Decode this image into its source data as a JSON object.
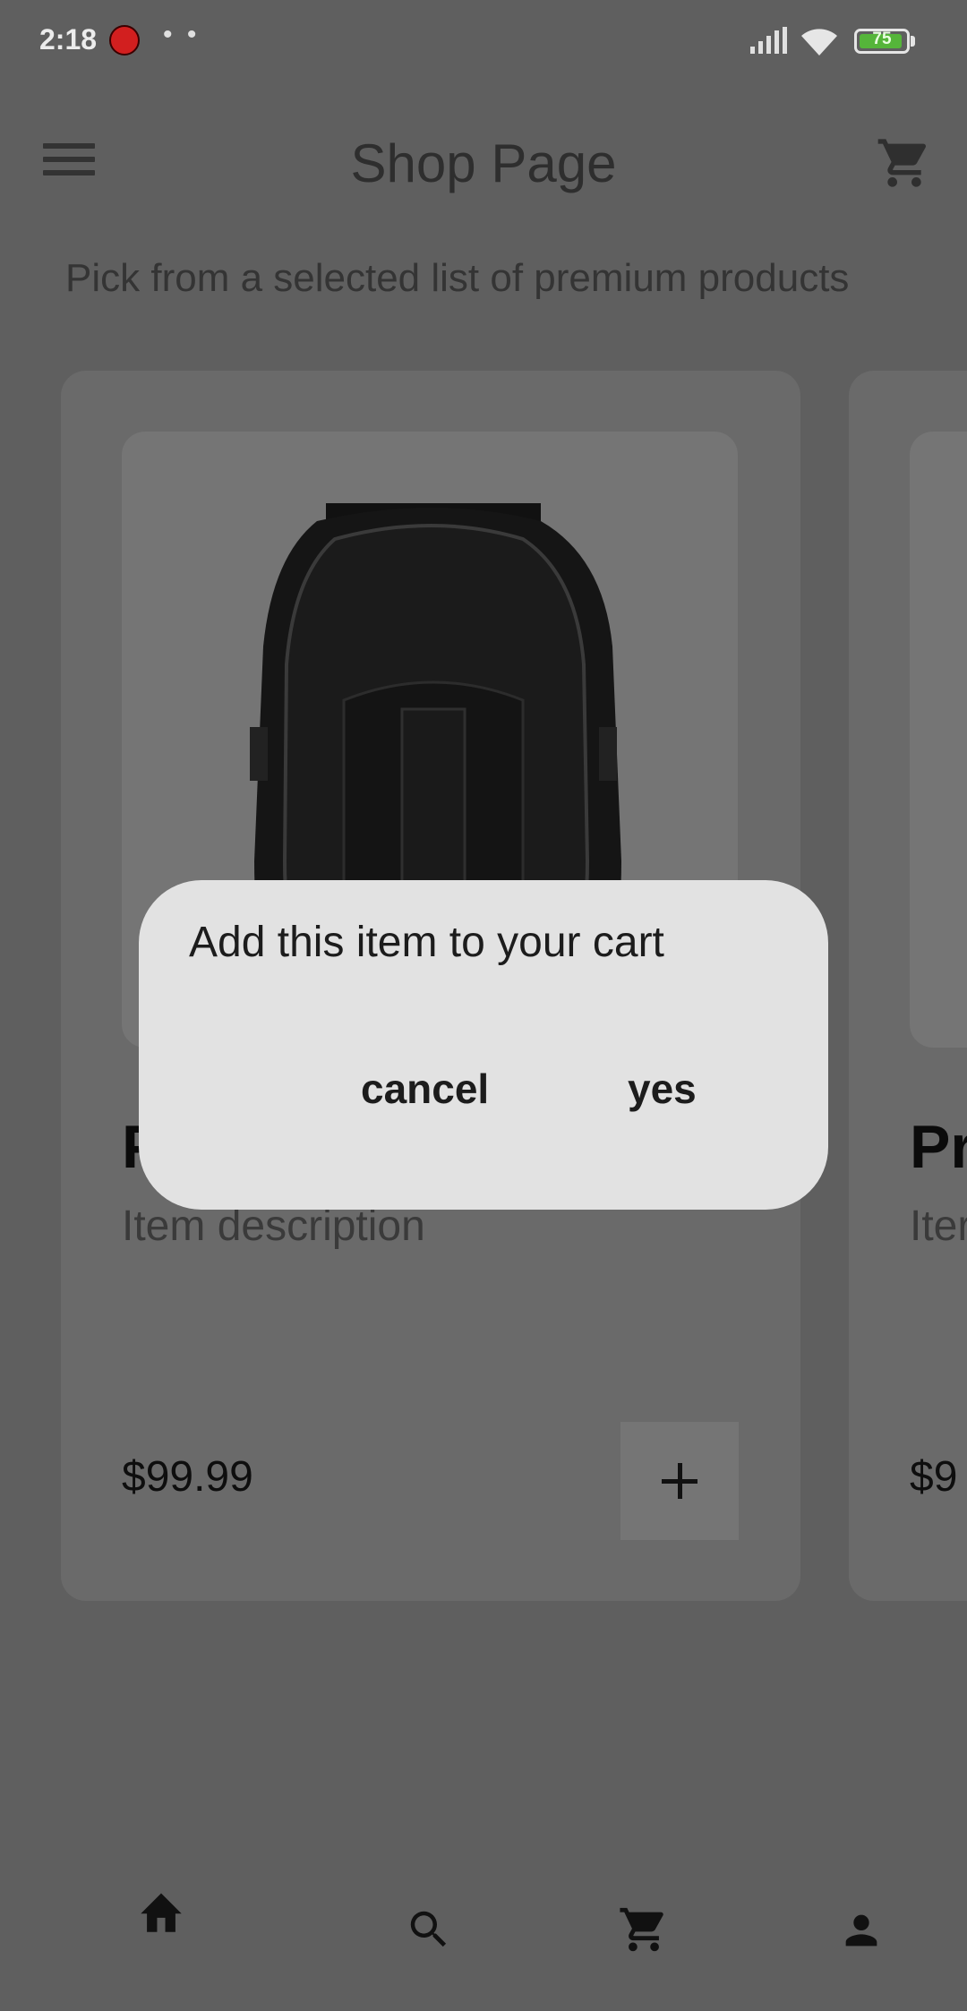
{
  "status_bar": {
    "time": "2:18",
    "dots": "• •",
    "battery_level": "75",
    "battery_color": "#55b53a"
  },
  "app_bar": {
    "title": "Shop Page",
    "menu_icon": "menu-icon",
    "cart_icon": "cart-icon"
  },
  "subtitle": "Pick from a selected list of premium products",
  "products": [
    {
      "name": "P",
      "description": "Item description",
      "price": "$99.99"
    },
    {
      "name": "Pr",
      "description": "Iter",
      "price": "$9"
    }
  ],
  "dialog": {
    "message": "Add this item to your cart",
    "cancel_label": "cancel",
    "confirm_label": "yes"
  },
  "bottom_nav": {
    "items": [
      "home-icon",
      "search-icon",
      "cart-icon",
      "person-icon"
    ]
  }
}
